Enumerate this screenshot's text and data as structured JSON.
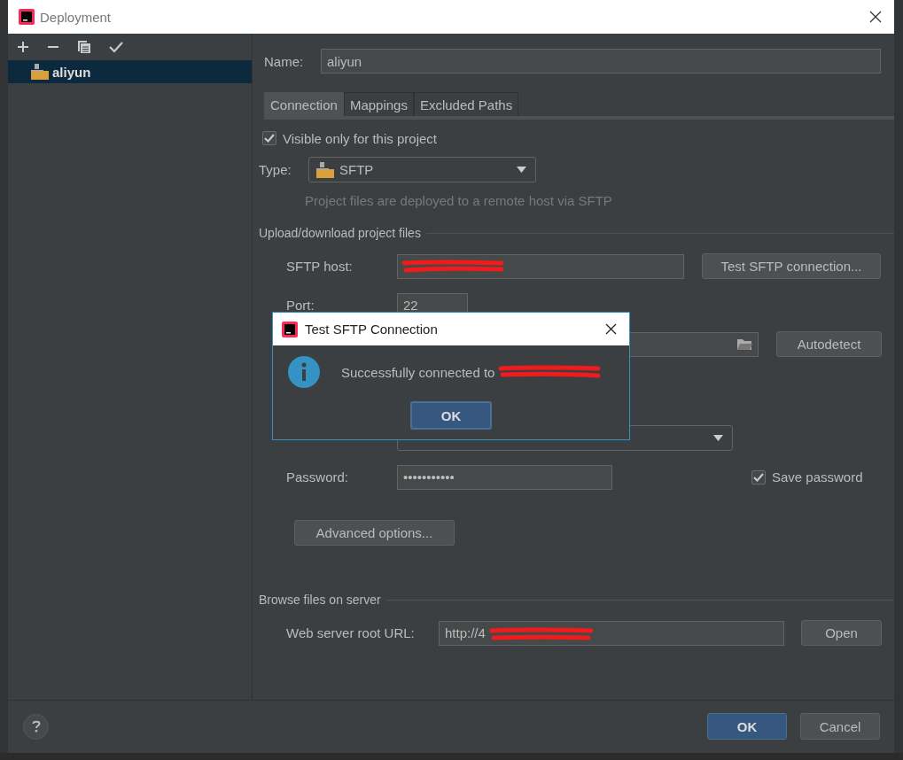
{
  "window": {
    "title": "Deployment"
  },
  "servers": [
    {
      "name": "aliyun",
      "selected": true
    }
  ],
  "name_field": {
    "label": "Name:",
    "value": "aliyun"
  },
  "tabs": [
    {
      "label": "Connection",
      "selected": true
    },
    {
      "label": "Mappings",
      "selected": false
    },
    {
      "label": "Excluded Paths",
      "selected": false
    }
  ],
  "visible_only": {
    "label": "Visible only for this project",
    "checked": true
  },
  "type": {
    "label": "Type:",
    "value": "SFTP",
    "hint": "Project files are deployed to a remote host via SFTP"
  },
  "upload_section": {
    "title": "Upload/download project files",
    "host": {
      "label": "SFTP host:",
      "redacted": true
    },
    "test_button": "Test SFTP connection...",
    "port": {
      "label": "Port:",
      "value": "22"
    },
    "autodetect_button": "Autodetect",
    "password": {
      "label": "Password:",
      "value": "•••••••••••"
    },
    "save_password": {
      "label": "Save password",
      "checked": true
    },
    "advanced_button": "Advanced options..."
  },
  "browse_section": {
    "title": "Browse files on server",
    "url": {
      "label": "Web server root URL:",
      "value": "http://4",
      "redacted": true
    },
    "open_button": "Open"
  },
  "footer": {
    "buttons": [
      {
        "label": "OK",
        "kind": "primary"
      },
      {
        "label": "Cancel",
        "kind": "default"
      }
    ]
  },
  "dialog": {
    "title": "Test SFTP Connection",
    "message": "Successfully connected to",
    "redacted": true,
    "button": "OK"
  }
}
